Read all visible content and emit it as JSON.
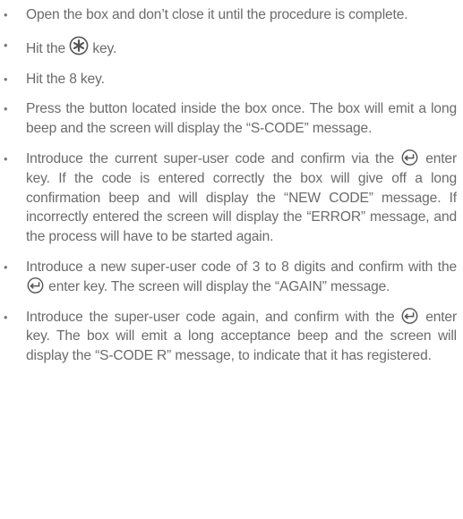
{
  "steps": [
    {
      "text": "Open the box and don’t close it until the procedure is complete."
    },
    {
      "before": "Hit the ",
      "icon": "asterisk-key-icon",
      "after": " key."
    },
    {
      "text": "Hit the 8 key."
    },
    {
      "text": "Press the button located inside the box once. The box will emit a long beep and the screen will display the “S-CODE” message."
    },
    {
      "before": "Introduce the current super-user code and confirm via the ",
      "icon": "enter-key-icon",
      "after": " enter key. If the code is entered correctly the box will give off a long confirmation beep and will display the “NEW CODE” message. If incorrectly entered the screen will display the “ERROR” message, and the process will have to be started again."
    },
    {
      "before": "Introduce a new super-user code of 3 to 8 digits and confirm with the ",
      "icon": "enter-key-icon",
      "after": " enter key. The screen will display the “AGAIN” message."
    },
    {
      "before": "Introduce the super-user code again, and confirm with the ",
      "icon": "enter-key-icon",
      "after": " enter key. The box will emit a long acceptance beep and the screen will display the “S-CODE R” message, to indicate that it has registered."
    }
  ],
  "colors": {
    "text": "#6b6b6b",
    "icon": "#555555"
  }
}
